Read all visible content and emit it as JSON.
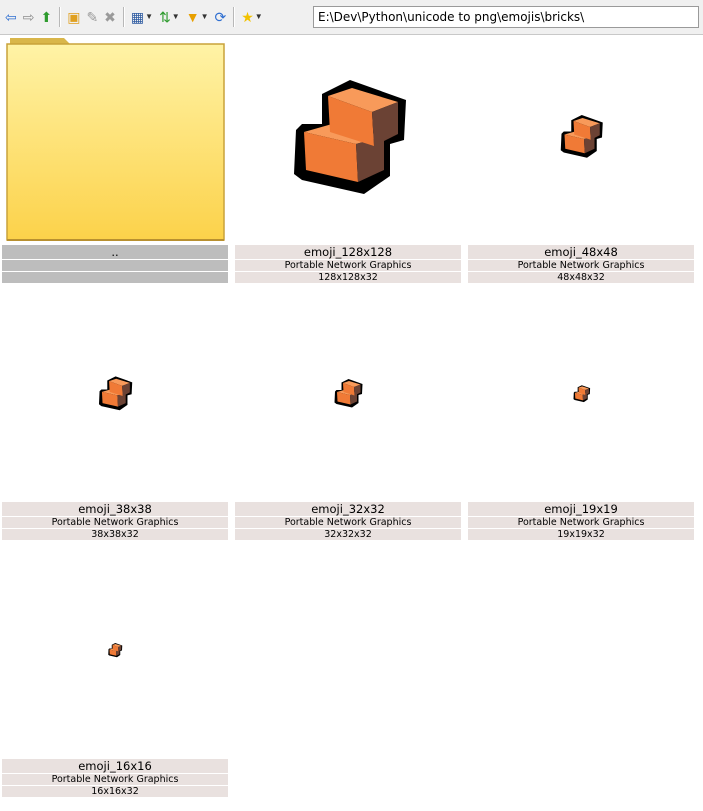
{
  "toolbar": {
    "buttons": [
      {
        "icon": "back-arrow-icon",
        "glyph": "⇦",
        "color": "#2f6fd1"
      },
      {
        "icon": "forward-arrow-icon",
        "glyph": "⇨",
        "color": "#8c8c8c"
      },
      {
        "icon": "up-folder-icon",
        "glyph": "⬆",
        "color": "#2e9b2e"
      },
      {
        "icon": "new-folder-icon",
        "glyph": "▣",
        "color": "#e0a020"
      },
      {
        "icon": "rename-icon",
        "glyph": "✎",
        "color": "#9a9a9a"
      },
      {
        "icon": "delete-icon",
        "glyph": "✖",
        "color": "#9a9a9a"
      },
      {
        "icon": "view-mode-icon",
        "glyph": "▦",
        "color": "#2d5aa0"
      },
      {
        "icon": "sort-icon",
        "glyph": "⇅",
        "color": "#2e9b2e"
      },
      {
        "icon": "filter-icon",
        "glyph": "▼",
        "color": "#e8a000"
      },
      {
        "icon": "refresh-icon",
        "glyph": "⟳",
        "color": "#2f6fd1"
      },
      {
        "icon": "favorites-star-icon",
        "glyph": "★",
        "color": "#f2c200"
      }
    ],
    "address": "E:\\Dev\\Python\\unicode to png\\emojis\\bricks\\"
  },
  "colors": {
    "brick_face": "#f07a36",
    "brick_top": "#f89a5a",
    "brick_side": "#6b4234",
    "outline": "#000000",
    "caption_bg": "#e9e1df",
    "parent_caption_bg": "#bdbdbd",
    "folder": "#fde87a"
  },
  "items": [
    {
      "name": "..",
      "type": "",
      "size": "",
      "kind": "folder"
    },
    {
      "name": "emoji_128x128",
      "type": "Portable Network Graphics",
      "size": "128x128x32",
      "kind": "image",
      "pixels": 128
    },
    {
      "name": "emoji_48x48",
      "type": "Portable Network Graphics",
      "size": "48x48x32",
      "kind": "image",
      "pixels": 48
    },
    {
      "name": "emoji_38x38",
      "type": "Portable Network Graphics",
      "size": "38x38x32",
      "kind": "image",
      "pixels": 38
    },
    {
      "name": "emoji_32x32",
      "type": "Portable Network Graphics",
      "size": "32x32x32",
      "kind": "image",
      "pixels": 32
    },
    {
      "name": "emoji_19x19",
      "type": "Portable Network Graphics",
      "size": "19x19x32",
      "kind": "image",
      "pixels": 19
    },
    {
      "name": "emoji_16x16",
      "type": "Portable Network Graphics",
      "size": "16x16x32",
      "kind": "image",
      "pixels": 16
    }
  ]
}
